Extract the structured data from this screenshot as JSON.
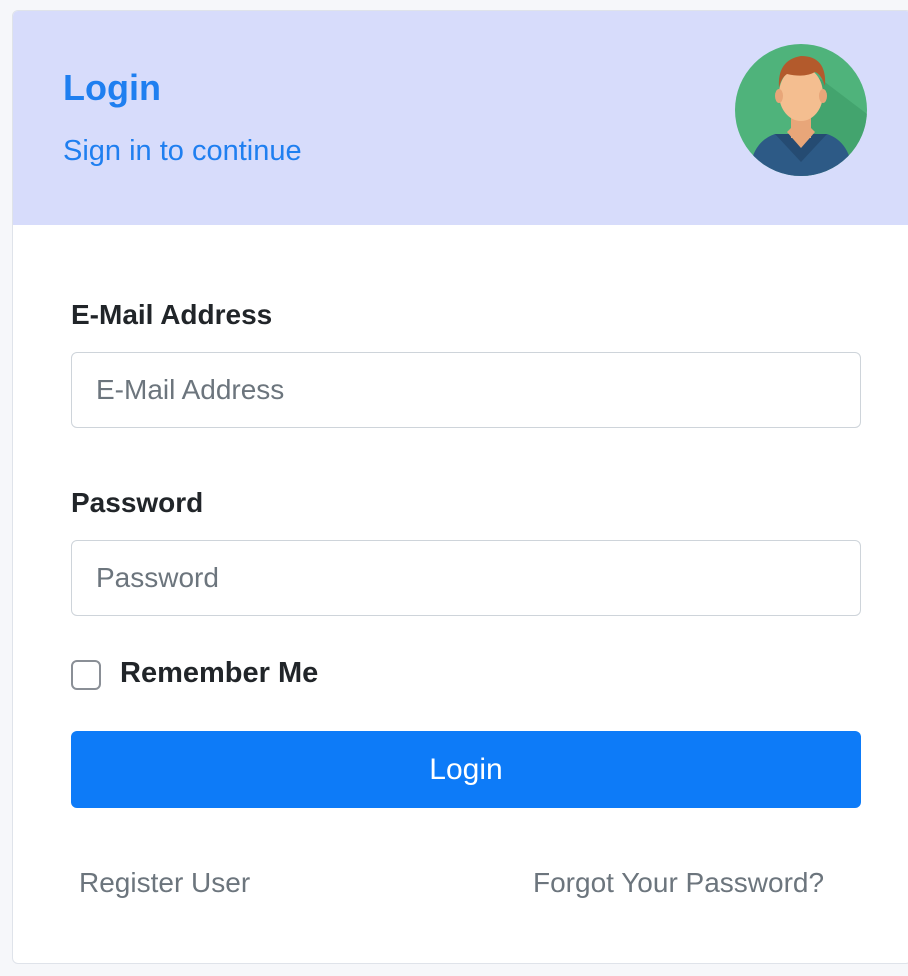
{
  "header": {
    "title": "Login",
    "subtitle": "Sign in to continue"
  },
  "form": {
    "email_label": "E-Mail Address",
    "email_placeholder": "E-Mail Address",
    "email_value": "",
    "password_label": "Password",
    "password_placeholder": "Password",
    "password_value": "",
    "remember_label": "Remember Me",
    "remember_checked": false,
    "login_label": "Login"
  },
  "links": {
    "register": "Register User",
    "forgot": "Forgot Your Password?"
  },
  "icons": {
    "avatar": "user-avatar-icon"
  },
  "colors": {
    "accent": "#0d7bf8",
    "header_bg": "#d7dcfb",
    "title": "#1f7ff0",
    "muted": "#6c757d"
  }
}
